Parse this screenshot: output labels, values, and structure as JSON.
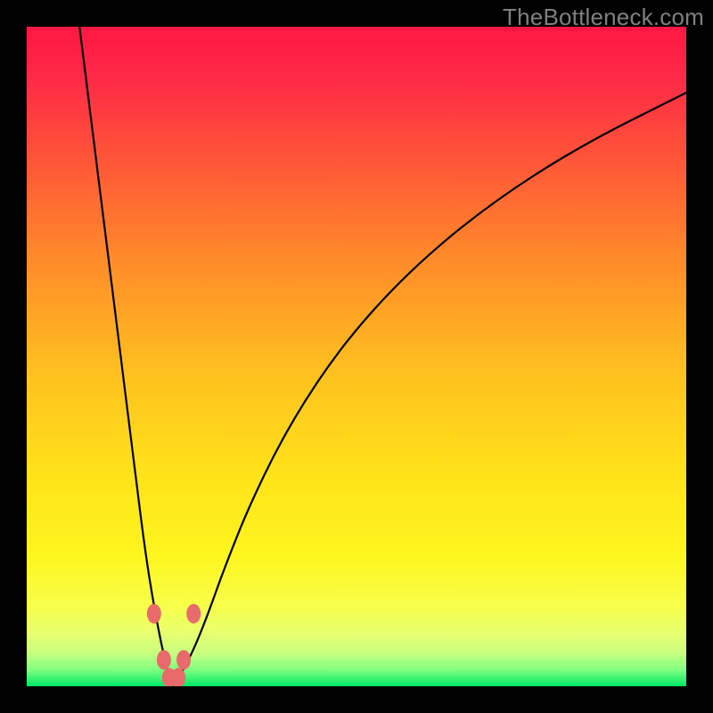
{
  "watermark": "TheBottleneck.com",
  "chart_data": {
    "type": "line",
    "title": "",
    "xlabel": "",
    "ylabel": "",
    "xlim": [
      0,
      100
    ],
    "ylim": [
      0,
      100
    ],
    "x_min_at": 22,
    "series": [
      {
        "name": "left-branch",
        "x": [
          8,
          10,
          12,
          14,
          16,
          18,
          19.5,
          20.5,
          21.3,
          22
        ],
        "values": [
          100,
          84,
          68,
          52,
          36,
          20,
          11,
          6,
          2.5,
          0
        ]
      },
      {
        "name": "right-branch",
        "x": [
          22,
          23,
          24,
          25.5,
          27.5,
          30,
          34,
          40,
          48,
          58,
          70,
          84,
          100
        ],
        "values": [
          0,
          1.2,
          3,
          6,
          11,
          18,
          28,
          40,
          52,
          63,
          73,
          82,
          90
        ]
      }
    ],
    "marker_points": [
      {
        "x": 19.3,
        "y": 11
      },
      {
        "x": 25.3,
        "y": 11
      },
      {
        "x": 20.8,
        "y": 4
      },
      {
        "x": 23.8,
        "y": 4
      },
      {
        "x": 21.6,
        "y": 1.3
      },
      {
        "x": 23.0,
        "y": 1.3
      }
    ],
    "gradient_stops": [
      {
        "offset": 0.0,
        "color": "#ff1744"
      },
      {
        "offset": 0.08,
        "color": "#ff2a46"
      },
      {
        "offset": 0.2,
        "color": "#ff5538"
      },
      {
        "offset": 0.35,
        "color": "#ff8a2a"
      },
      {
        "offset": 0.52,
        "color": "#ffbf1f"
      },
      {
        "offset": 0.68,
        "color": "#ffe31a"
      },
      {
        "offset": 0.8,
        "color": "#fff51e"
      },
      {
        "offset": 0.88,
        "color": "#f7ff4a"
      },
      {
        "offset": 0.92,
        "color": "#e8ff70"
      },
      {
        "offset": 0.95,
        "color": "#c8ff80"
      },
      {
        "offset": 0.975,
        "color": "#80ff80"
      },
      {
        "offset": 1.0,
        "color": "#00e868"
      }
    ],
    "marker_color": "#e86a6a",
    "curve_color": "#000000"
  }
}
